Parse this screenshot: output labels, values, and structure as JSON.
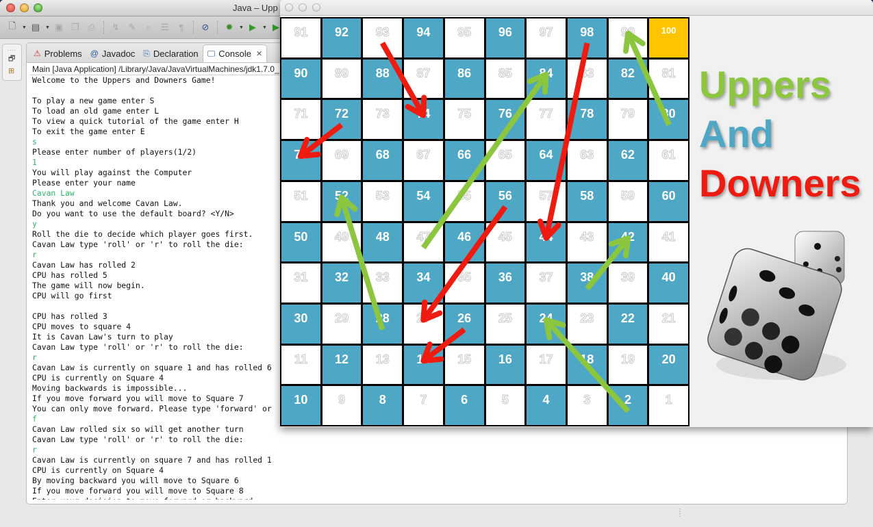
{
  "eclipse": {
    "title": "Java – Upp",
    "toolbar_icons": [
      "new-wizard-icon",
      "new-class-icon",
      "save-icon",
      "save-all-icon",
      "print-icon",
      "open-type-icon",
      "edit-icon",
      "search-icon",
      "toggle-block-icon",
      "show-whitespace-icon",
      "skip-breakpoints-icon",
      "debug-icon",
      "run-icon",
      "run-external-icon",
      "new-package-icon"
    ],
    "tabs": [
      {
        "label": "Problems",
        "icon": "problems-icon",
        "active": false
      },
      {
        "label": "Javadoc",
        "icon": "@",
        "active": false
      },
      {
        "label": "Declaration",
        "icon": "declaration-icon",
        "active": false
      },
      {
        "label": "Console",
        "icon": "console-icon",
        "active": true
      }
    ],
    "console_header": "Main [Java Application] /Library/Java/JavaVirtualMachines/jdk1.7.0_",
    "console_lines": [
      {
        "text": "Welcome to the Uppers and Downers Game!",
        "input": false
      },
      {
        "text": "",
        "input": false
      },
      {
        "text": "To play a new game enter S",
        "input": false
      },
      {
        "text": "To load an old game enter L",
        "input": false
      },
      {
        "text": "To view a quick tutorial of the game enter H",
        "input": false
      },
      {
        "text": "To exit the game enter E",
        "input": false
      },
      {
        "text": "s",
        "input": true
      },
      {
        "text": "Please enter number of players(1/2)",
        "input": false
      },
      {
        "text": "1",
        "input": true
      },
      {
        "text": "You will play against the Computer",
        "input": false
      },
      {
        "text": "Please enter your name",
        "input": false
      },
      {
        "text": "Cavan Law",
        "input": true
      },
      {
        "text": "Thank you and welcome Cavan Law.",
        "input": false
      },
      {
        "text": "Do you want to use the default board? <Y/N>",
        "input": false
      },
      {
        "text": "y",
        "input": true
      },
      {
        "text": "Roll the die to decide which player goes first.",
        "input": false
      },
      {
        "text": "Cavan Law type 'roll' or 'r' to roll the die:",
        "input": false
      },
      {
        "text": "r",
        "input": true
      },
      {
        "text": "Cavan Law has rolled 2",
        "input": false
      },
      {
        "text": "CPU has rolled 5",
        "input": false
      },
      {
        "text": "The game will now begin.",
        "input": false
      },
      {
        "text": "CPU will go first",
        "input": false
      },
      {
        "text": "",
        "input": false
      },
      {
        "text": "CPU has rolled 3",
        "input": false
      },
      {
        "text": "CPU moves to square 4",
        "input": false
      },
      {
        "text": "It is Cavan Law's turn to play",
        "input": false
      },
      {
        "text": "Cavan Law type 'roll' or 'r' to roll the die:",
        "input": false
      },
      {
        "text": "r",
        "input": true
      },
      {
        "text": "Cavan Law is currently on square 1 and has rolled 6",
        "input": false
      },
      {
        "text": "CPU is currently on Square 4",
        "input": false
      },
      {
        "text": "Moving backwards is impossible...",
        "input": false
      },
      {
        "text": "If you move forward you will move to Square 7",
        "input": false
      },
      {
        "text": "You can only move forward. Please type 'forward' or",
        "input": false
      },
      {
        "text": "f",
        "input": true
      },
      {
        "text": "Cavan Law rolled six so will get another turn",
        "input": false
      },
      {
        "text": "Cavan Law type 'roll' or 'r' to roll the die:",
        "input": false
      },
      {
        "text": "r",
        "input": true
      },
      {
        "text": "Cavan Law is currently on square 7 and has rolled 1",
        "input": false
      },
      {
        "text": "CPU is currently on Square 4",
        "input": false
      },
      {
        "text": "By moving backward you will move to Square 6",
        "input": false
      },
      {
        "text": "If you move forward you will move to Square 8",
        "input": false
      },
      {
        "text": "Enter your decision to move forward or backward",
        "input": false
      }
    ]
  },
  "game": {
    "logo": {
      "line1": "Uppers",
      "line2": "And",
      "line3": "Downers"
    },
    "colors": {
      "blue": "#4fa7c6",
      "white": "#ffffff",
      "gold": "#ffc400",
      "upper": "#8cc63f",
      "downer": "#ee1c10"
    },
    "board_rows": [
      [
        91,
        92,
        93,
        94,
        95,
        96,
        97,
        98,
        99,
        100
      ],
      [
        90,
        89,
        88,
        87,
        86,
        85,
        84,
        83,
        82,
        81
      ],
      [
        71,
        72,
        73,
        74,
        75,
        76,
        77,
        78,
        79,
        80
      ],
      [
        70,
        69,
        68,
        67,
        66,
        65,
        64,
        63,
        62,
        61
      ],
      [
        51,
        52,
        53,
        54,
        55,
        56,
        57,
        58,
        59,
        60
      ],
      [
        50,
        49,
        48,
        47,
        46,
        45,
        44,
        43,
        42,
        41
      ],
      [
        31,
        32,
        33,
        34,
        35,
        36,
        37,
        38,
        39,
        40
      ],
      [
        30,
        29,
        28,
        27,
        26,
        25,
        24,
        23,
        22,
        21
      ],
      [
        11,
        12,
        13,
        14,
        15,
        16,
        17,
        18,
        19,
        20
      ],
      [
        10,
        9,
        8,
        7,
        6,
        5,
        4,
        3,
        2,
        1
      ]
    ],
    "uppers": [
      {
        "from": 2,
        "to": 24
      },
      {
        "from": 28,
        "to": 52
      },
      {
        "from": 47,
        "to": 84
      },
      {
        "from": 38,
        "to": 42
      },
      {
        "from": 80,
        "to": 99
      }
    ],
    "downers": [
      {
        "from": 93,
        "to": 74
      },
      {
        "from": 72,
        "to": 70
      },
      {
        "from": 98,
        "to": 44
      },
      {
        "from": 56,
        "to": 27
      },
      {
        "from": 26,
        "to": 14
      }
    ]
  }
}
